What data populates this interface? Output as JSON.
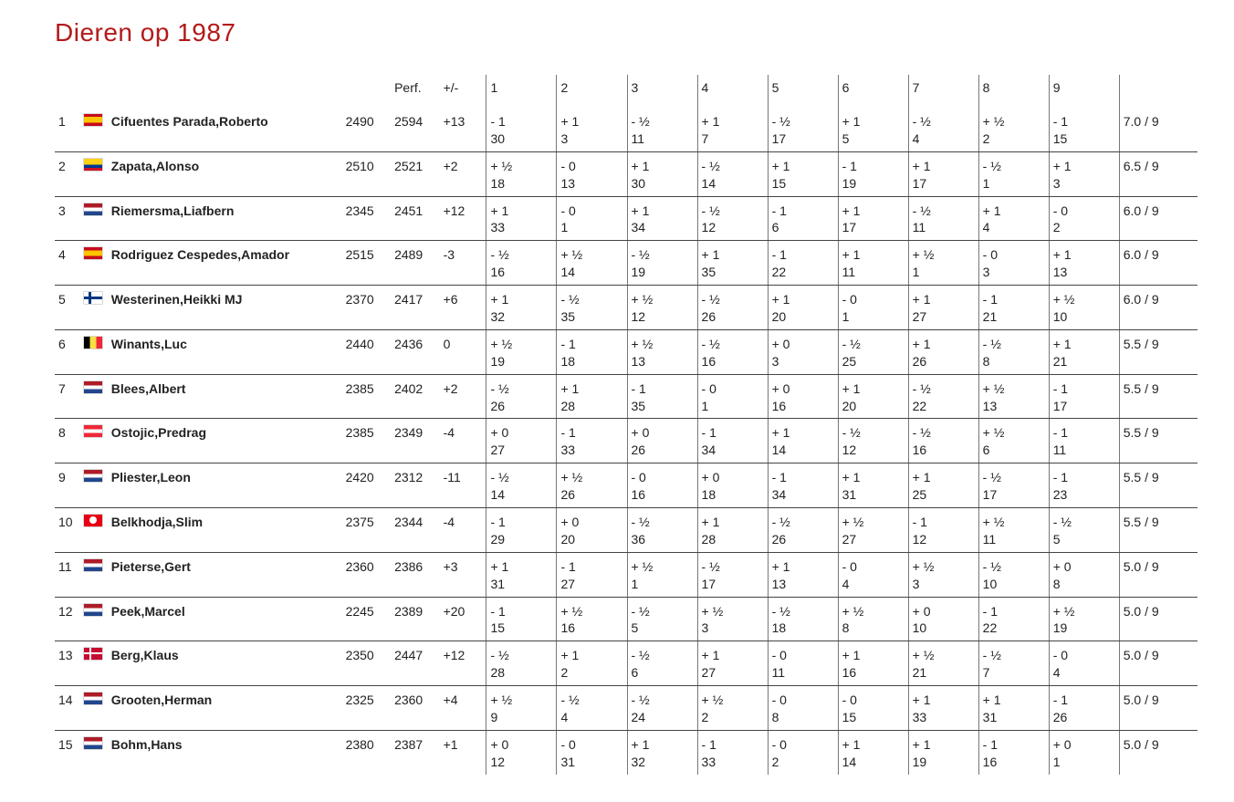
{
  "title": "Dieren op   1987",
  "headers": {
    "perf": "Perf.",
    "plusminus": "+/-",
    "rounds": [
      "1",
      "2",
      "3",
      "4",
      "5",
      "6",
      "7",
      "8",
      "9"
    ]
  },
  "rows": [
    {
      "rank": "1",
      "flag": "es",
      "name": "Cifuentes Parada,Roberto",
      "rating": "2490",
      "perf": "2594",
      "pm": "+13",
      "rounds": [
        {
          "r": "- 1",
          "o": "30"
        },
        {
          "r": "+ 1",
          "o": "3"
        },
        {
          "r": "- ½",
          "o": "11"
        },
        {
          "r": "+ 1",
          "o": "7"
        },
        {
          "r": "- ½",
          "o": "17"
        },
        {
          "r": "+ 1",
          "o": "5"
        },
        {
          "r": "- ½",
          "o": "4"
        },
        {
          "r": "+ ½",
          "o": "2"
        },
        {
          "r": "- 1",
          "o": "15"
        }
      ],
      "score": "7.0 / 9"
    },
    {
      "rank": "2",
      "flag": "co",
      "name": "Zapata,Alonso",
      "rating": "2510",
      "perf": "2521",
      "pm": "+2",
      "rounds": [
        {
          "r": "+ ½",
          "o": "18"
        },
        {
          "r": "- 0",
          "o": "13"
        },
        {
          "r": "+ 1",
          "o": "30"
        },
        {
          "r": "- ½",
          "o": "14"
        },
        {
          "r": "+ 1",
          "o": "15"
        },
        {
          "r": "- 1",
          "o": "19"
        },
        {
          "r": "+ 1",
          "o": "17"
        },
        {
          "r": "- ½",
          "o": "1"
        },
        {
          "r": "+ 1",
          "o": "3"
        }
      ],
      "score": "6.5 / 9"
    },
    {
      "rank": "3",
      "flag": "nl",
      "name": "Riemersma,Liafbern",
      "rating": "2345",
      "perf": "2451",
      "pm": "+12",
      "rounds": [
        {
          "r": "+ 1",
          "o": "33"
        },
        {
          "r": "- 0",
          "o": "1"
        },
        {
          "r": "+ 1",
          "o": "34"
        },
        {
          "r": "- ½",
          "o": "12"
        },
        {
          "r": "- 1",
          "o": "6"
        },
        {
          "r": "+ 1",
          "o": "17"
        },
        {
          "r": "- ½",
          "o": "11"
        },
        {
          "r": "+ 1",
          "o": "4"
        },
        {
          "r": "- 0",
          "o": "2"
        }
      ],
      "score": "6.0 / 9"
    },
    {
      "rank": "4",
      "flag": "es",
      "name": "Rodriguez Cespedes,Amador",
      "rating": "2515",
      "perf": "2489",
      "pm": "-3",
      "rounds": [
        {
          "r": "- ½",
          "o": "16"
        },
        {
          "r": "+ ½",
          "o": "14"
        },
        {
          "r": "- ½",
          "o": "19"
        },
        {
          "r": "+ 1",
          "o": "35"
        },
        {
          "r": "- 1",
          "o": "22"
        },
        {
          "r": "+ 1",
          "o": "11"
        },
        {
          "r": "+ ½",
          "o": "1"
        },
        {
          "r": "- 0",
          "o": "3"
        },
        {
          "r": "+ 1",
          "o": "13"
        }
      ],
      "score": "6.0 / 9"
    },
    {
      "rank": "5",
      "flag": "fi",
      "name": "Westerinen,Heikki MJ",
      "rating": "2370",
      "perf": "2417",
      "pm": "+6",
      "rounds": [
        {
          "r": "+ 1",
          "o": "32"
        },
        {
          "r": "- ½",
          "o": "35"
        },
        {
          "r": "+ ½",
          "o": "12"
        },
        {
          "r": "- ½",
          "o": "26"
        },
        {
          "r": "+ 1",
          "o": "20"
        },
        {
          "r": "- 0",
          "o": "1"
        },
        {
          "r": "+ 1",
          "o": "27"
        },
        {
          "r": "- 1",
          "o": "21"
        },
        {
          "r": "+ ½",
          "o": "10"
        }
      ],
      "score": "6.0 / 9"
    },
    {
      "rank": "6",
      "flag": "be",
      "name": "Winants,Luc",
      "rating": "2440",
      "perf": "2436",
      "pm": "0",
      "rounds": [
        {
          "r": "+ ½",
          "o": "19"
        },
        {
          "r": "- 1",
          "o": "18"
        },
        {
          "r": "+ ½",
          "o": "13"
        },
        {
          "r": "- ½",
          "o": "16"
        },
        {
          "r": "+ 0",
          "o": "3"
        },
        {
          "r": "- ½",
          "o": "25"
        },
        {
          "r": "+ 1",
          "o": "26"
        },
        {
          "r": "- ½",
          "o": "8"
        },
        {
          "r": "+ 1",
          "o": "21"
        }
      ],
      "score": "5.5 / 9"
    },
    {
      "rank": "7",
      "flag": "nl",
      "name": "Blees,Albert",
      "rating": "2385",
      "perf": "2402",
      "pm": "+2",
      "rounds": [
        {
          "r": "- ½",
          "o": "26"
        },
        {
          "r": "+ 1",
          "o": "28"
        },
        {
          "r": "- 1",
          "o": "35"
        },
        {
          "r": "- 0",
          "o": "1"
        },
        {
          "r": "+ 0",
          "o": "16"
        },
        {
          "r": "+ 1",
          "o": "20"
        },
        {
          "r": "- ½",
          "o": "22"
        },
        {
          "r": "+ ½",
          "o": "13"
        },
        {
          "r": "- 1",
          "o": "17"
        }
      ],
      "score": "5.5 / 9"
    },
    {
      "rank": "8",
      "flag": "at",
      "name": "Ostojic,Predrag",
      "rating": "2385",
      "perf": "2349",
      "pm": "-4",
      "rounds": [
        {
          "r": "+ 0",
          "o": "27"
        },
        {
          "r": "- 1",
          "o": "33"
        },
        {
          "r": "+ 0",
          "o": "26"
        },
        {
          "r": "- 1",
          "o": "34"
        },
        {
          "r": "+ 1",
          "o": "14"
        },
        {
          "r": "- ½",
          "o": "12"
        },
        {
          "r": "- ½",
          "o": "16"
        },
        {
          "r": "+ ½",
          "o": "6"
        },
        {
          "r": "- 1",
          "o": "11"
        }
      ],
      "score": "5.5 / 9"
    },
    {
      "rank": "9",
      "flag": "nl",
      "name": "Pliester,Leon",
      "rating": "2420",
      "perf": "2312",
      "pm": "-11",
      "rounds": [
        {
          "r": "- ½",
          "o": "14"
        },
        {
          "r": "+ ½",
          "o": "26"
        },
        {
          "r": "- 0",
          "o": "16"
        },
        {
          "r": "+ 0",
          "o": "18"
        },
        {
          "r": "- 1",
          "o": "34"
        },
        {
          "r": "+ 1",
          "o": "31"
        },
        {
          "r": "+ 1",
          "o": "25"
        },
        {
          "r": "- ½",
          "o": "17"
        },
        {
          "r": "- 1",
          "o": "23"
        }
      ],
      "score": "5.5 / 9"
    },
    {
      "rank": "10",
      "flag": "tn",
      "name": "Belkhodja,Slim",
      "rating": "2375",
      "perf": "2344",
      "pm": "-4",
      "rounds": [
        {
          "r": "- 1",
          "o": "29"
        },
        {
          "r": "+ 0",
          "o": "20"
        },
        {
          "r": "- ½",
          "o": "36"
        },
        {
          "r": "+ 1",
          "o": "28"
        },
        {
          "r": "- ½",
          "o": "26"
        },
        {
          "r": "+ ½",
          "o": "27"
        },
        {
          "r": "- 1",
          "o": "12"
        },
        {
          "r": "+ ½",
          "o": "11"
        },
        {
          "r": "- ½",
          "o": "5"
        }
      ],
      "score": "5.5 / 9"
    },
    {
      "rank": "11",
      "flag": "nl",
      "name": "Pieterse,Gert",
      "rating": "2360",
      "perf": "2386",
      "pm": "+3",
      "rounds": [
        {
          "r": "+ 1",
          "o": "31"
        },
        {
          "r": "- 1",
          "o": "27"
        },
        {
          "r": "+ ½",
          "o": "1"
        },
        {
          "r": "- ½",
          "o": "17"
        },
        {
          "r": "+ 1",
          "o": "13"
        },
        {
          "r": "- 0",
          "o": "4"
        },
        {
          "r": "+ ½",
          "o": "3"
        },
        {
          "r": "- ½",
          "o": "10"
        },
        {
          "r": "+ 0",
          "o": "8"
        }
      ],
      "score": "5.0 / 9"
    },
    {
      "rank": "12",
      "flag": "nl",
      "name": "Peek,Marcel",
      "rating": "2245",
      "perf": "2389",
      "pm": "+20",
      "rounds": [
        {
          "r": "- 1",
          "o": "15"
        },
        {
          "r": "+ ½",
          "o": "16"
        },
        {
          "r": "- ½",
          "o": "5"
        },
        {
          "r": "+ ½",
          "o": "3"
        },
        {
          "r": "- ½",
          "o": "18"
        },
        {
          "r": "+ ½",
          "o": "8"
        },
        {
          "r": "+ 0",
          "o": "10"
        },
        {
          "r": "- 1",
          "o": "22"
        },
        {
          "r": "+ ½",
          "o": "19"
        }
      ],
      "score": "5.0 / 9"
    },
    {
      "rank": "13",
      "flag": "dk",
      "name": "Berg,Klaus",
      "rating": "2350",
      "perf": "2447",
      "pm": "+12",
      "rounds": [
        {
          "r": "- ½",
          "o": "28"
        },
        {
          "r": "+ 1",
          "o": "2"
        },
        {
          "r": "- ½",
          "o": "6"
        },
        {
          "r": "+ 1",
          "o": "27"
        },
        {
          "r": "- 0",
          "o": "11"
        },
        {
          "r": "+ 1",
          "o": "16"
        },
        {
          "r": "+ ½",
          "o": "21"
        },
        {
          "r": "- ½",
          "o": "7"
        },
        {
          "r": "- 0",
          "o": "4"
        }
      ],
      "score": "5.0 / 9"
    },
    {
      "rank": "14",
      "flag": "nl",
      "name": "Grooten,Herman",
      "rating": "2325",
      "perf": "2360",
      "pm": "+4",
      "rounds": [
        {
          "r": "+ ½",
          "o": "9"
        },
        {
          "r": "- ½",
          "o": "4"
        },
        {
          "r": "- ½",
          "o": "24"
        },
        {
          "r": "+ ½",
          "o": "2"
        },
        {
          "r": "- 0",
          "o": "8"
        },
        {
          "r": "- 0",
          "o": "15"
        },
        {
          "r": "+ 1",
          "o": "33"
        },
        {
          "r": "+ 1",
          "o": "31"
        },
        {
          "r": "- 1",
          "o": "26"
        }
      ],
      "score": "5.0 / 9"
    },
    {
      "rank": "15",
      "flag": "nl",
      "name": "Bohm,Hans",
      "rating": "2380",
      "perf": "2387",
      "pm": "+1",
      "rounds": [
        {
          "r": "+ 0",
          "o": "12"
        },
        {
          "r": "- 0",
          "o": "31"
        },
        {
          "r": "+ 1",
          "o": "32"
        },
        {
          "r": "- 1",
          "o": "33"
        },
        {
          "r": "- 0",
          "o": "2"
        },
        {
          "r": "+ 1",
          "o": "14"
        },
        {
          "r": "+ 1",
          "o": "19"
        },
        {
          "r": "- 1",
          "o": "16"
        },
        {
          "r": "+ 0",
          "o": "1"
        }
      ],
      "score": "5.0 / 9"
    }
  ]
}
